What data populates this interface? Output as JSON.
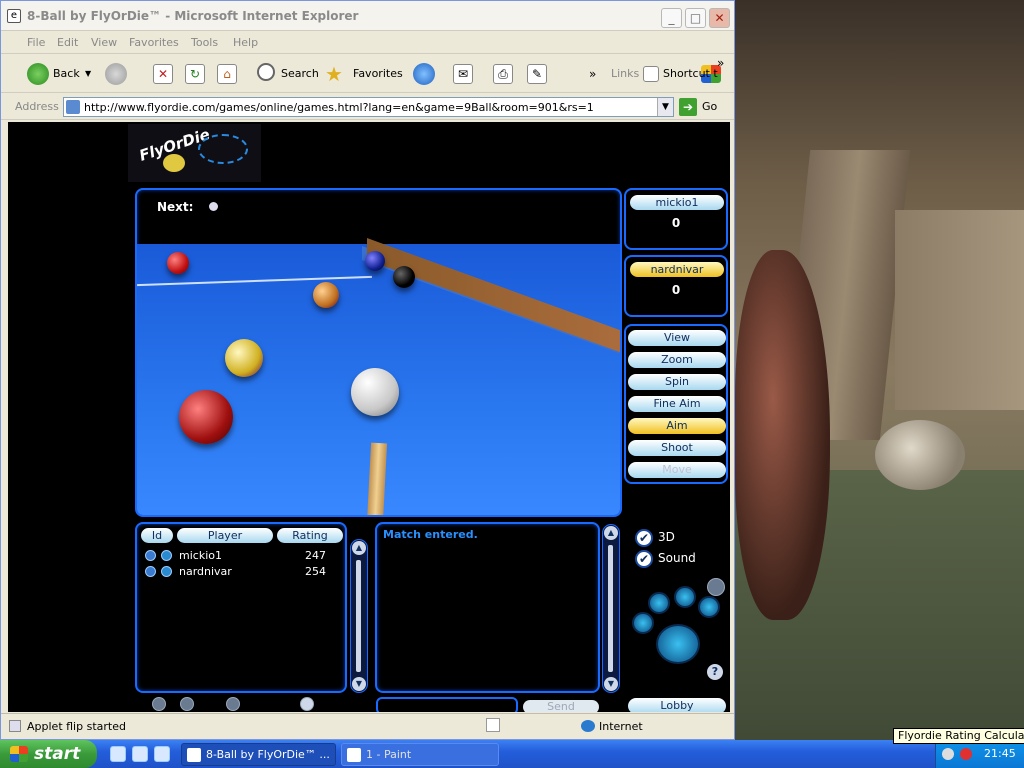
{
  "window": {
    "title": "8-Ball by FlyOrDie™ - Microsoft Internet Explorer",
    "icon": "ie-page-icon",
    "minimize": "_",
    "maximize": "□",
    "close": "✕"
  },
  "menu": [
    "File",
    "Edit",
    "View",
    "Favorites",
    "Tools",
    "Help"
  ],
  "toolbar": {
    "back": "Back",
    "search": "Search",
    "favorites": "Favorites",
    "links": "Links",
    "shortcut": "Shortcut t",
    "more": "»"
  },
  "address": {
    "label": "Address",
    "url": "http://www.flyordie.com/games/online/games.html?lang=en&game=9Ball&room=901&rs=1",
    "go": "Go",
    "dropdown": "▼"
  },
  "game": {
    "logo": "FlyOrDie",
    "next_label": "Next:",
    "players_top": [
      {
        "name": "mickio1",
        "score": "0"
      },
      {
        "name": "nardnivar",
        "score": "0"
      }
    ],
    "controls": [
      {
        "label": "View",
        "state": "normal"
      },
      {
        "label": "Zoom",
        "state": "normal"
      },
      {
        "label": "Spin",
        "state": "normal"
      },
      {
        "label": "Fine Aim",
        "state": "normal"
      },
      {
        "label": "Aim",
        "state": "active"
      },
      {
        "label": "Shoot",
        "state": "normal"
      },
      {
        "label": "Move",
        "state": "disabled"
      }
    ],
    "player_table": {
      "headers": [
        "Id",
        "Player",
        "Rating"
      ],
      "rows": [
        {
          "name": "mickio1",
          "rating": "247"
        },
        {
          "name": "nardnivar",
          "rating": "254"
        }
      ]
    },
    "chat_message": "Match entered.",
    "options": [
      {
        "label": "3D",
        "checked": true
      },
      {
        "label": "Sound",
        "checked": true
      }
    ],
    "check_mark": "✔",
    "help": "?",
    "send": "Send",
    "lobby": "Lobby",
    "scroll_up": "▲",
    "scroll_down": "▼"
  },
  "status": {
    "text": "Applet flip started",
    "zone": "Internet"
  },
  "taskbar": {
    "start": "start",
    "tasks": [
      {
        "label": "8-Ball by FlyOrDie™ ...",
        "active": true
      },
      {
        "label": "1 - Paint",
        "active": false
      }
    ],
    "clock": "21:45",
    "tooltip": "Flyordie Rating Calculator"
  },
  "colors": {
    "accent_blue": "#1a6aff",
    "felt": "#2a78f0",
    "chat_text": "#2a90ff",
    "active_button": "#f0c020"
  }
}
